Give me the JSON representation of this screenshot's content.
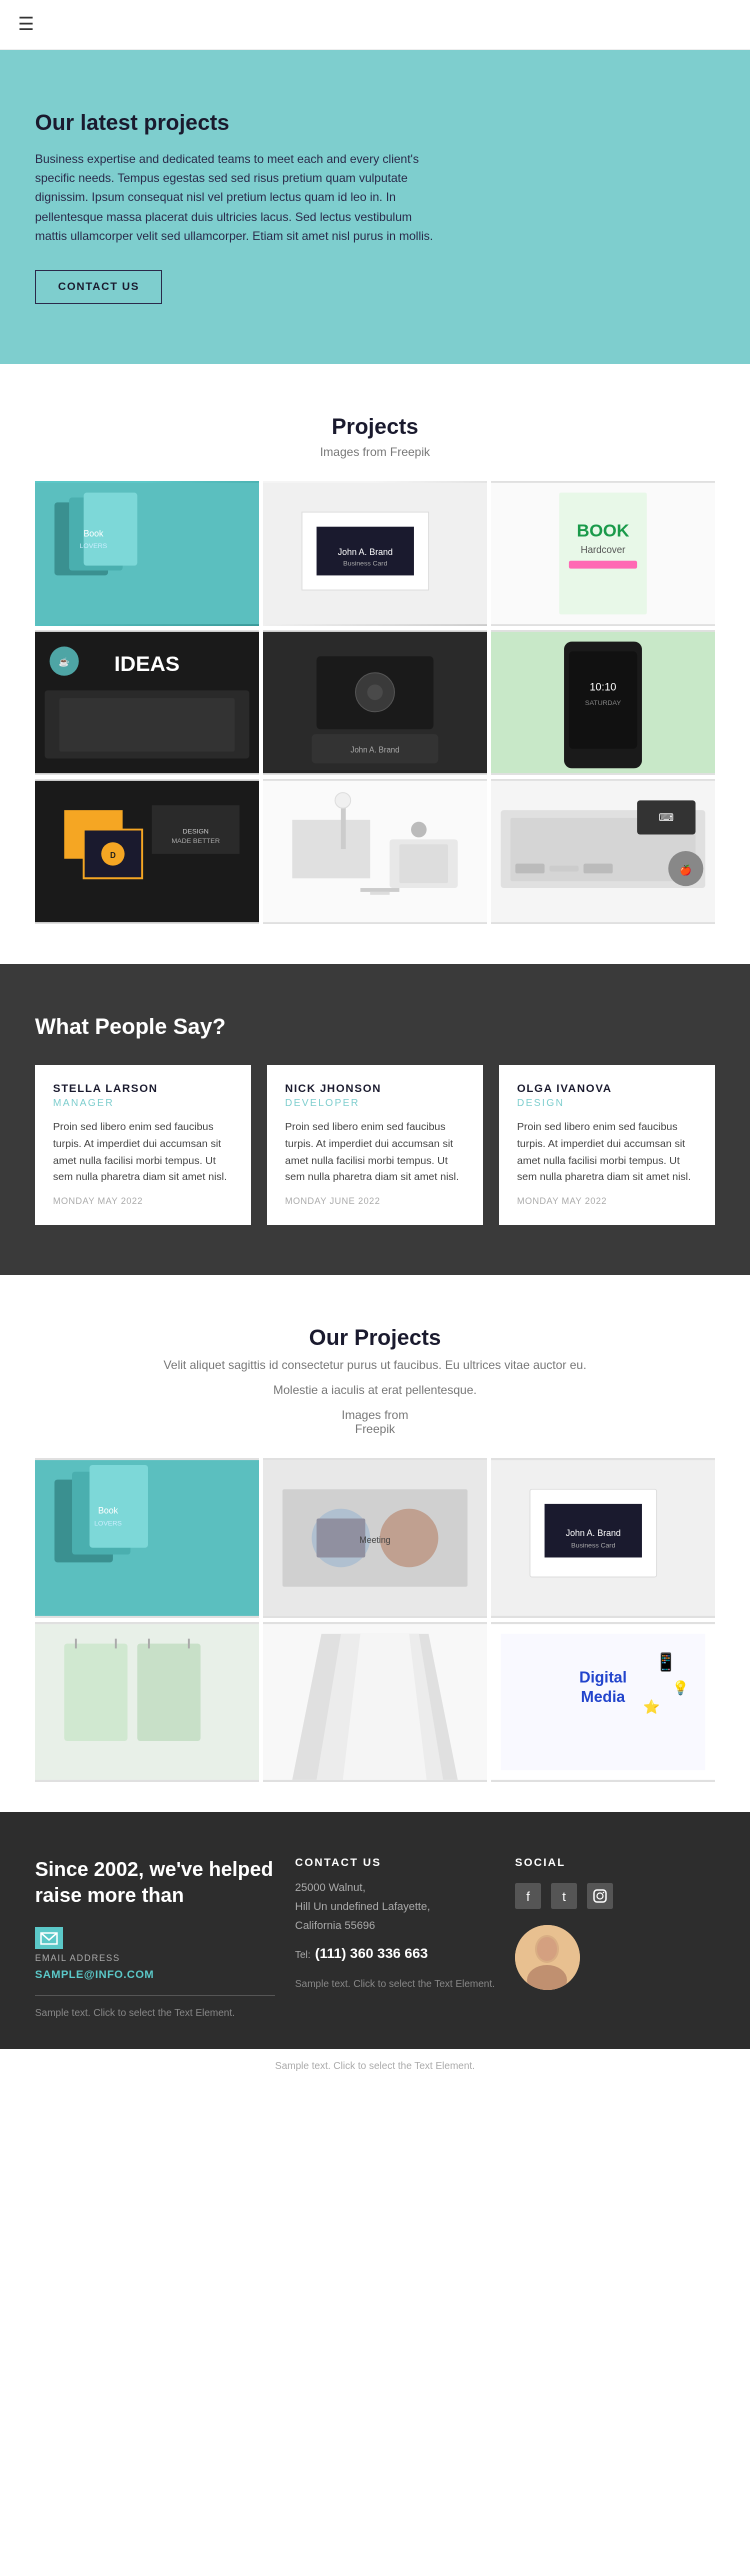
{
  "nav": {
    "hamburger_icon": "☰"
  },
  "hero": {
    "title": "Our latest projects",
    "text": "Business expertise and dedicated teams to meet each and every client's specific needs. Tempus egestas sed sed risus pretium quam vulputate dignissim. Ipsum consequat nisl vel pretium lectus quam id leo in. In pellentesque massa placerat duis ultricies lacus. Sed lectus vestibulum mattis ullamcorper velit sed ullamcorper. Etiam sit amet nisl purus in mollis.",
    "cta_label": "CONTACT US"
  },
  "projects_section": {
    "title": "Projects",
    "subtitle": "Images from Freepik",
    "images": [
      {
        "id": "books-teal",
        "label": "Books Teal"
      },
      {
        "id": "business-cards-white",
        "label": "Business Cards"
      },
      {
        "id": "book-colorful",
        "label": "Book Hardcover"
      },
      {
        "id": "laptop-ideas",
        "label": "Ideas Laptop"
      },
      {
        "id": "cards-dark",
        "label": "Cards Dark"
      },
      {
        "id": "phone-green",
        "label": "Phone Green"
      },
      {
        "id": "cards-orange",
        "label": "Cards Orange"
      },
      {
        "id": "desk-lamp",
        "label": "Desk Lamp"
      },
      {
        "id": "keyboard-top",
        "label": "Keyboard Top"
      }
    ]
  },
  "testimonials": {
    "title": "What People Say?",
    "items": [
      {
        "name": "STELLA LARSON",
        "role": "MANAGER",
        "text": "Proin sed libero enim sed faucibus turpis. At imperdiet dui accumsan sit amet nulla facilisi morbi tempus. Ut sem nulla pharetra diam sit amet nisl.",
        "date": "MONDAY MAY 2022"
      },
      {
        "name": "NICK JHONSON",
        "role": "DEVELOPER",
        "text": "Proin sed libero enim sed faucibus turpis. At imperdiet dui accumsan sit amet nulla facilisi morbi tempus. Ut sem nulla pharetra diam sit amet nisl.",
        "date": "MONDAY JUNE 2022"
      },
      {
        "name": "OLGA IVANOVA",
        "role": "DESIGN",
        "text": "Proin sed libero enim sed faucibus turpis. At imperdiet dui accumsan sit amet nulla facilisi morbi tempus. Ut sem nulla pharetra diam sit amet nisl.",
        "date": "MONDAY MAY 2022"
      }
    ]
  },
  "our_projects": {
    "title": "Our Projects",
    "desc1": "Velit aliquet sagittis id consectetur purus ut faucibus. Eu ultrices vitae auctor eu.",
    "desc2": "Molestie a iaculis at erat pellentesque.",
    "images_from": "Images from",
    "freepik": "Freepik",
    "images": [
      {
        "id": "books-teal2",
        "label": "Books Teal"
      },
      {
        "id": "meeting",
        "label": "Meeting"
      },
      {
        "id": "business-cards2",
        "label": "Business Cards"
      },
      {
        "id": "bags-green",
        "label": "Bags Green"
      },
      {
        "id": "paper-white",
        "label": "Paper White"
      },
      {
        "id": "digital-media",
        "label": "Digital Media"
      }
    ]
  },
  "footer": {
    "tagline": "Since 2002, we've helped raise more than",
    "email_label": "EMAIL ADDRESS",
    "email_value": "SAMPLE@INFO.COM",
    "sample_text": "Sample text. Click to select the Text Element.",
    "contact_title": "CONTACT US",
    "address": "25000 Walnut,\nHill Un undefined Lafayette,\nCalifornia 55696",
    "tel_label": "Tel:",
    "tel_value": "(111) 360 336 663",
    "contact_sample": "Sample text. Click to select\nthe Text Element.",
    "social_title": "SOCIAL",
    "social_icons": [
      "f",
      "t",
      "i"
    ],
    "bottom_sample": "Sample text. Click to select the Text Element."
  }
}
